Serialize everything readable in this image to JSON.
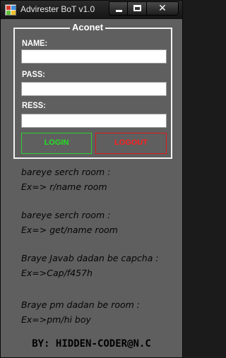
{
  "window": {
    "title": "Advirester BoT v1.0",
    "minimize_glyph": "",
    "close_glyph": "✕"
  },
  "login_group": {
    "title": "Aconet",
    "name_label": "NAME:",
    "pass_label": "PASS:",
    "ress_label": "RESS:",
    "name_value": "",
    "pass_value": "",
    "ress_value": "",
    "login_label": "LOGIN",
    "logout_label": "LOGOUT"
  },
  "help": {
    "lines": [
      "bareye serch room :",
      "Ex=> r/name room",
      "bareye serch room :",
      "Ex=> get/name room",
      "Braye Javab dadan be capcha :",
      "Ex=>Cap/f457h",
      "Braye pm dadan be room :",
      "Ex=>pm/hi boy"
    ]
  },
  "footer": {
    "credit": "BY: HIDDEN-CODER@N.C"
  },
  "colors": {
    "login": "#22e022",
    "logout": "#ff2020",
    "background": "#5f5f5f"
  }
}
